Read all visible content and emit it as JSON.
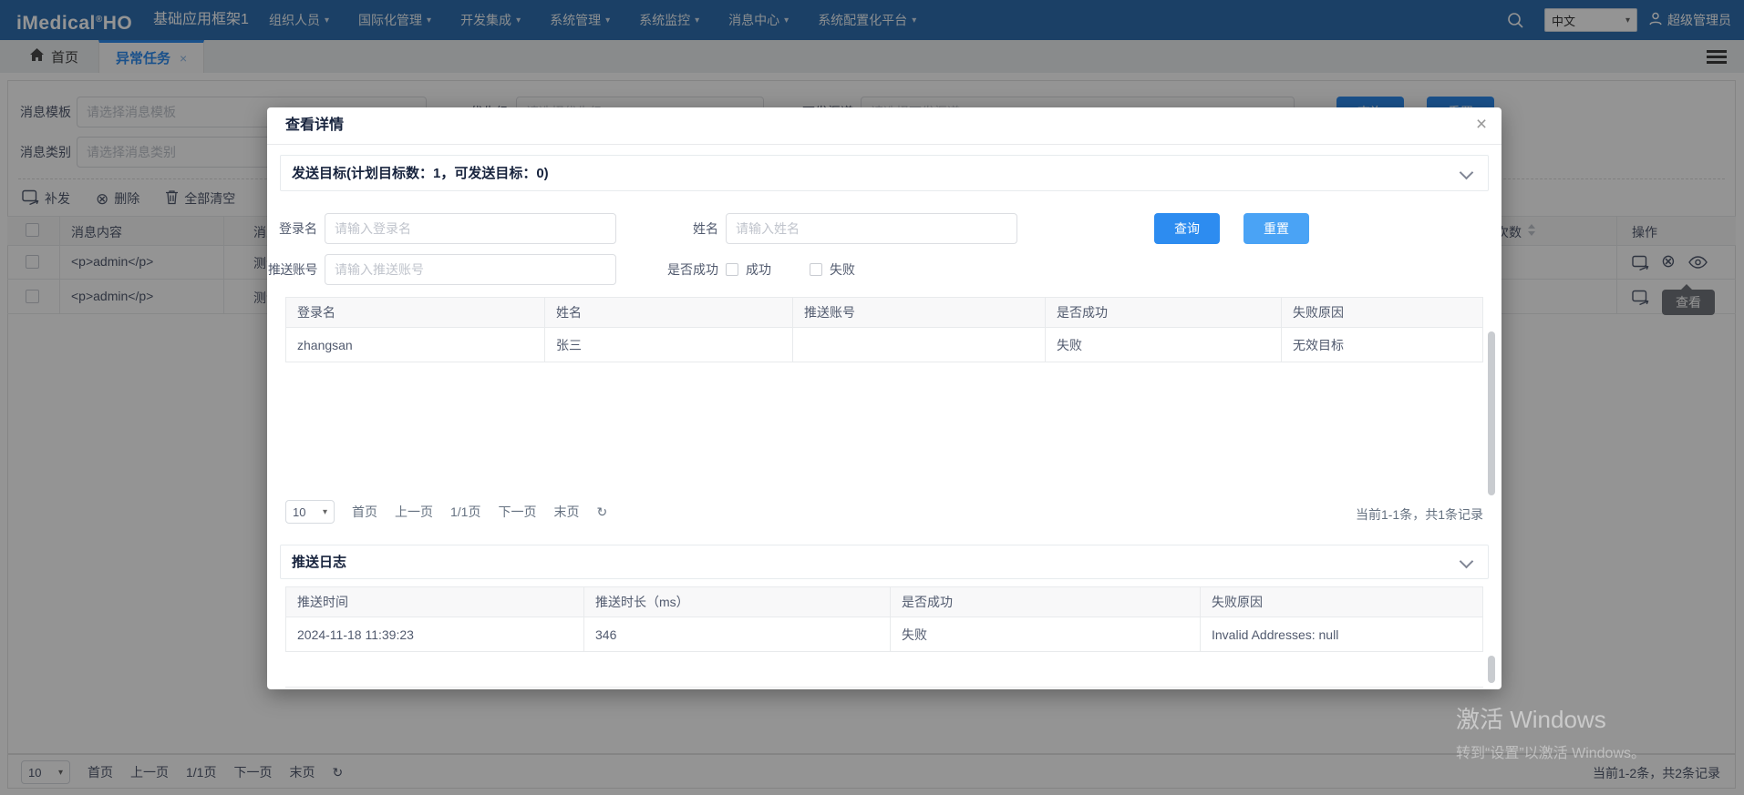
{
  "icons": {
    "caret": "▾",
    "close": "×",
    "circle_x": "⊗",
    "refresh": "↻",
    "reg": "®"
  },
  "navbar": {
    "logo": "iMedical",
    "logo_suffix": "HO",
    "app_title": "基础应用框架1",
    "menus": [
      "组织人员",
      "国际化管理",
      "开发集成",
      "系统管理",
      "系统监控",
      "消息中心",
      "系统配置化平台"
    ],
    "language": "中文",
    "user": "超级管理员"
  },
  "tabs": {
    "home": "首页",
    "active": "异常任务"
  },
  "filters": {
    "template_label": "消息模板",
    "template_placeholder": "请选择消息模板",
    "category_label": "消息类别",
    "category_placeholder": "请选择消息类别",
    "priority_label": "优先级",
    "priority_placeholder": "请选择优先级",
    "channel_label": "下发渠道",
    "channel_placeholder": "请选择下发渠道",
    "search_label": "查询",
    "reset_label": "重置"
  },
  "toolbar": {
    "resend_label": "补发",
    "delete_label": "删除",
    "clear_label": "全部清空"
  },
  "background_table": {
    "header_content": "消息内容",
    "header_clipped": "消息类别",
    "header_count": "次数",
    "header_action": "操作",
    "rows": [
      {
        "content": "<p>admin</p>",
        "clipped": "测试"
      },
      {
        "content": "<p>admin</p>",
        "clipped": "测试"
      }
    ],
    "tooltip": "查看"
  },
  "background_pagination": {
    "page_size": "10",
    "first": "首页",
    "prev": "上一页",
    "page": "1/1页",
    "next": "下一页",
    "last": "末页",
    "summary": "当前1-2条，共2条记录"
  },
  "watermark": {
    "line1": "激活 Windows",
    "line2": "转到“设置”以激活 Windows。"
  },
  "modal": {
    "title": "查看详情",
    "target_section": {
      "title": "发送目标(计划目标数：1，可发送目标：0)",
      "login_label": "登录名",
      "login_placeholder": "请输入登录名",
      "name_label": "姓名",
      "name_placeholder": "请输入姓名",
      "account_label": "推送账号",
      "account_placeholder": "请输入推送账号",
      "success_label": "是否成功",
      "success_option": "成功",
      "fail_option": "失败",
      "search_label": "查询",
      "reset_label": "重置",
      "table": {
        "headers": [
          "登录名",
          "姓名",
          "推送账号",
          "是否成功",
          "失败原因"
        ],
        "rows": [
          [
            "zhangsan",
            "张三",
            "",
            "失败",
            "无效目标"
          ]
        ]
      },
      "pagination": {
        "page_size": "10",
        "first": "首页",
        "prev": "上一页",
        "page": "1/1页",
        "next": "下一页",
        "last": "末页",
        "summary": "当前1-1条，共1条记录"
      }
    },
    "log_section": {
      "title": "推送日志",
      "table": {
        "headers": [
          "推送时间",
          "推送时长（ms）",
          "是否成功",
          "失败原因"
        ],
        "rows": [
          [
            "2024-11-18 11:39:23",
            "346",
            "失败",
            "Invalid Addresses: null"
          ]
        ]
      }
    }
  }
}
